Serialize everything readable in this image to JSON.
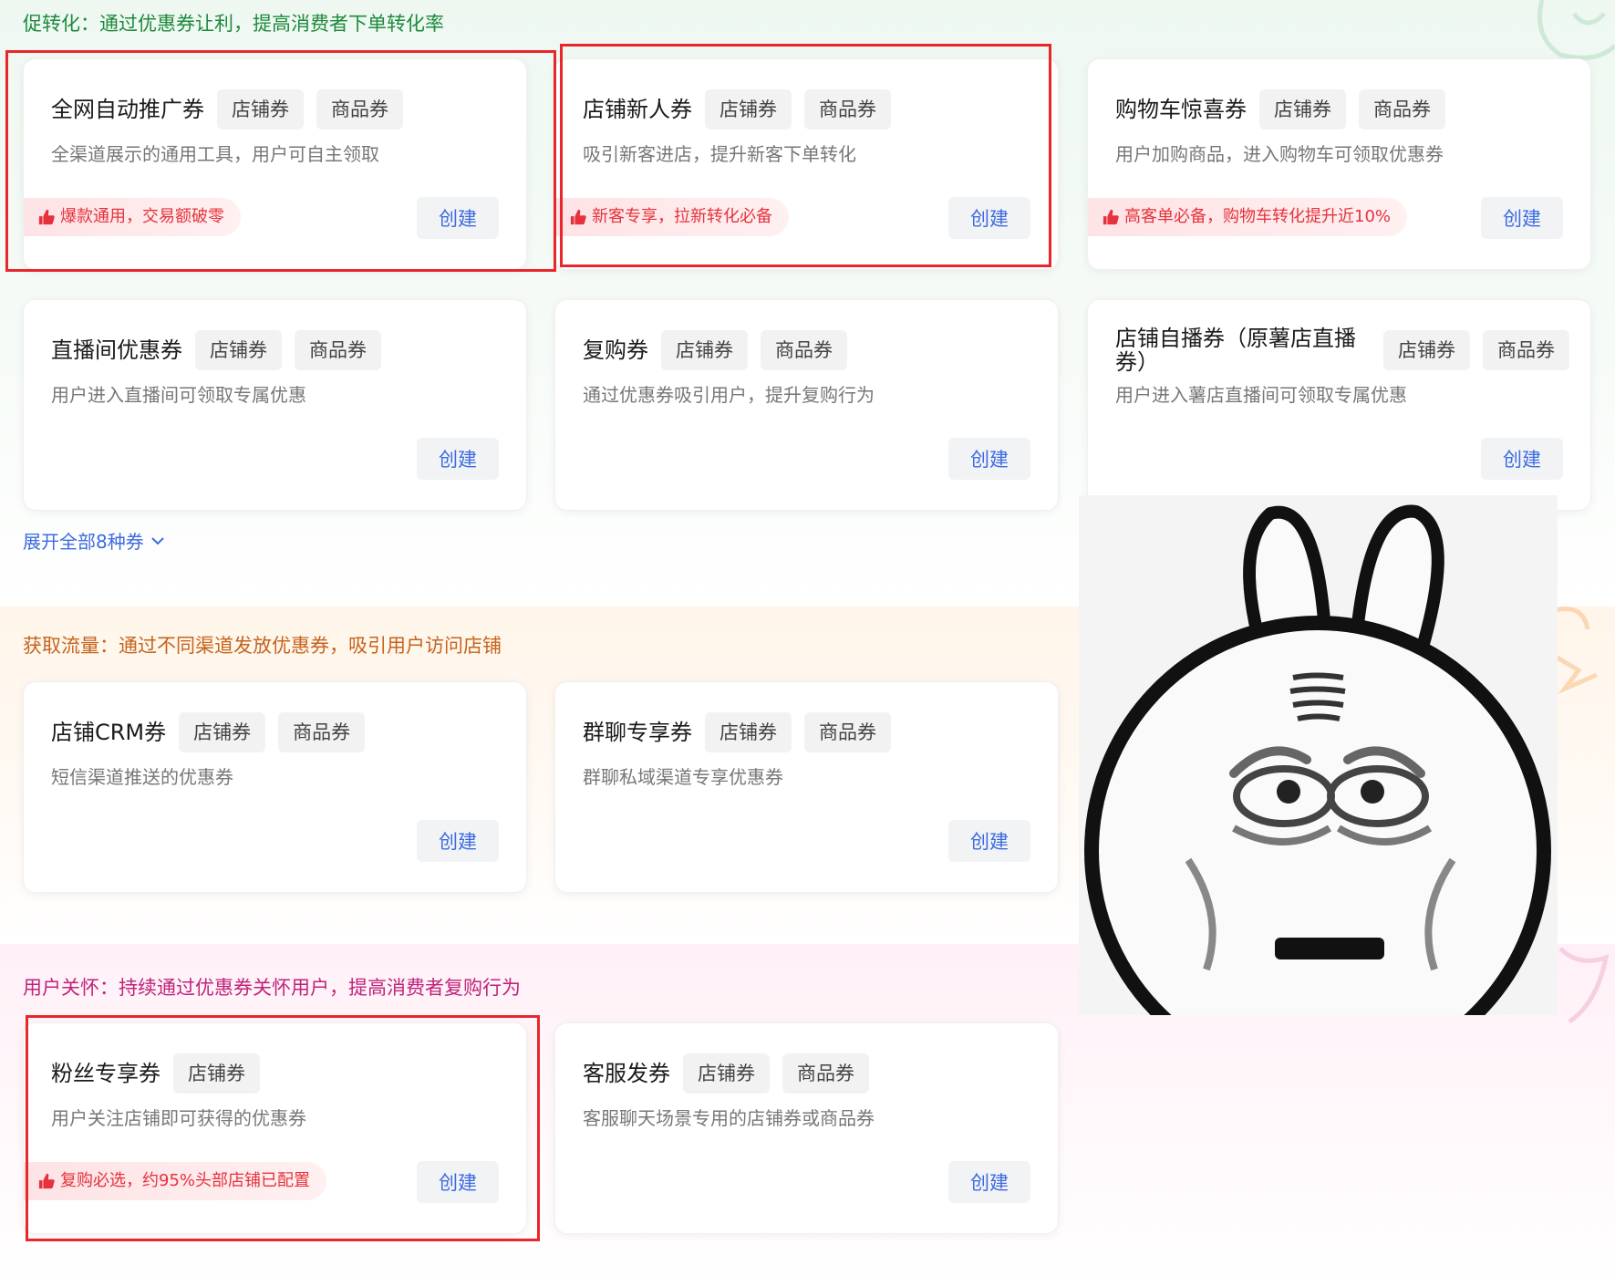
{
  "sections": {
    "conversion": {
      "title": "促转化：通过优惠券让利，提高消费者下单转化率"
    },
    "traffic": {
      "title": "获取流量：通过不同渠道发放优惠券，吸引用户访问店铺"
    },
    "care": {
      "title": "用户关怀：持续通过优惠券关怀用户，提高消费者复购行为"
    }
  },
  "expand_label": "展开全部8种券",
  "create_label": "创建",
  "cards": [
    {
      "name": "全网自动推广券",
      "tags": [
        "店铺券",
        "商品券"
      ],
      "desc": "全渠道展示的通用工具，用户可自主领取",
      "badge": "爆款通用，交易额破零"
    },
    {
      "name": "店铺新人券",
      "tags": [
        "店铺券",
        "商品券"
      ],
      "desc": "吸引新客进店，提升新客下单转化",
      "badge": "新客专享，拉新转化必备"
    },
    {
      "name": "购物车惊喜券",
      "tags": [
        "店铺券",
        "商品券"
      ],
      "desc": "用户加购商品，进入购物车可领取优惠券",
      "badge": "高客单必备，购物车转化提升近10%"
    },
    {
      "name": "直播间优惠券",
      "tags": [
        "店铺券",
        "商品券"
      ],
      "desc": "用户进入直播间可领取专属优惠"
    },
    {
      "name": "复购券",
      "tags": [
        "店铺券",
        "商品券"
      ],
      "desc": "通过优惠券吸引用户，提升复购行为"
    },
    {
      "name": "店铺自播券（原薯店直播券）",
      "tags": [
        "店铺券",
        "商品券"
      ],
      "desc": "用户进入薯店直播间可领取专属优惠"
    },
    {
      "name": "店铺CRM券",
      "tags": [
        "店铺券",
        "商品券"
      ],
      "desc": "短信渠道推送的优惠券"
    },
    {
      "name": "群聊专享券",
      "tags": [
        "店铺券",
        "商品券"
      ],
      "desc": "群聊私域渠道专享优惠券"
    },
    {
      "name": "粉丝专享券",
      "tags": [
        "店铺券"
      ],
      "desc": "用户关注店铺即可获得的优惠券",
      "badge": "复购必选，约95%头部店铺已配置"
    },
    {
      "name": "客服发券",
      "tags": [
        "店铺券",
        "商品券"
      ],
      "desc": "客服聊天场景专用的店铺券或商品券"
    }
  ],
  "colors": {
    "conversion_title": "#1e8a3c",
    "traffic_title": "#c5641c",
    "care_title": "#c0237a",
    "link_blue": "#3d6be0",
    "badge_red": "#e6323c",
    "annotation_red": "#e8262b"
  },
  "icons": {
    "badge": "thumbs-up-icon",
    "expand": "chevron-down-icon"
  },
  "sticker": "rabbit-sticker"
}
